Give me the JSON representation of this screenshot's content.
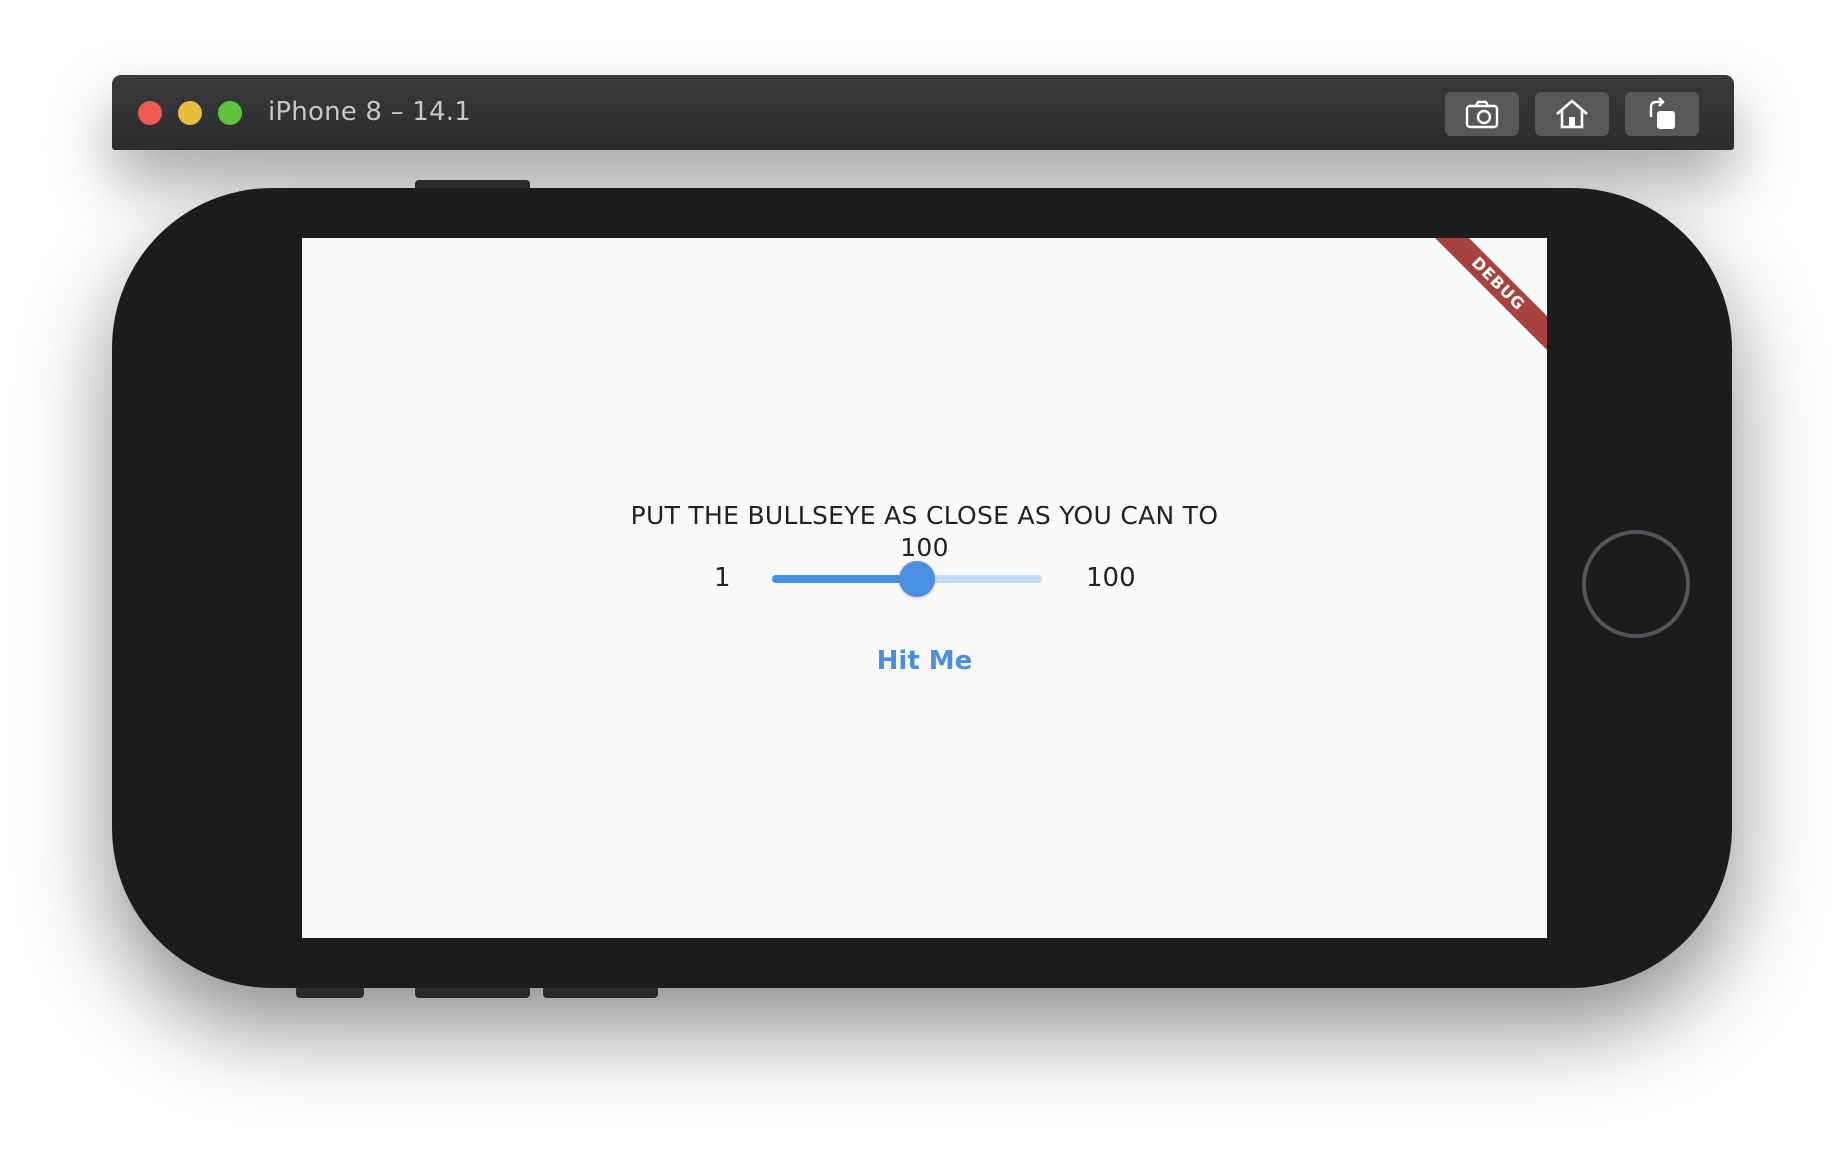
{
  "window": {
    "title": "iPhone 8 – 14.1",
    "toolbar": {
      "screenshot_icon": "camera-icon",
      "home_icon": "home-icon",
      "rotate_icon": "rotate-icon"
    }
  },
  "app": {
    "debug_banner": "DEBUG",
    "prompt_line1": "PUT THE BULLSEYE AS CLOSE AS YOU CAN TO",
    "prompt_line2": "100",
    "slider": {
      "min_label": "1",
      "max_label": "100",
      "value": 54,
      "min": 1,
      "max": 100
    },
    "hit_button_label": "Hit Me",
    "colors": {
      "accent": "#4a90e2",
      "track_inactive": "#c3dcf5",
      "debug_banner": "#a7423f"
    }
  }
}
